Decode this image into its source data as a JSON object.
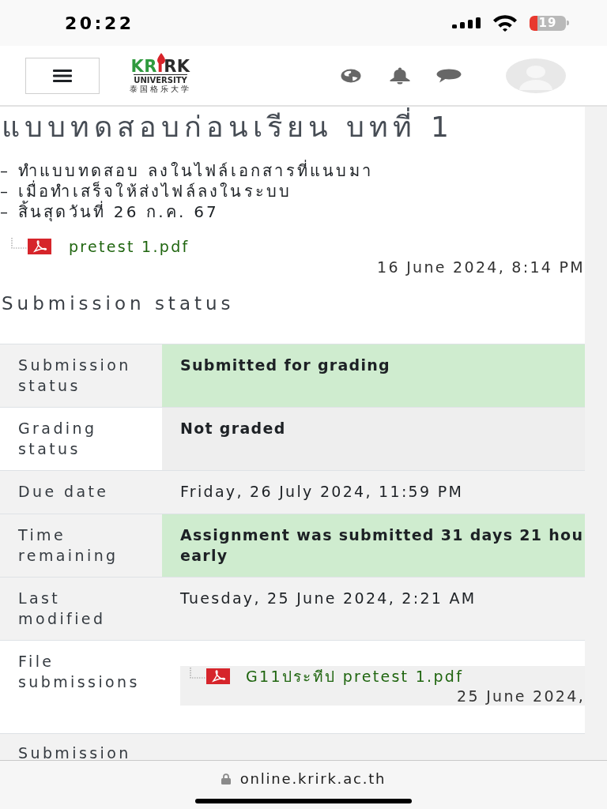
{
  "status_bar": {
    "time": "20:22",
    "battery": "19"
  },
  "header": {
    "logo": {
      "wordmark": "KRIRK",
      "subtitle": "UNIVERSITY",
      "chinese": "泰国格乐大学"
    }
  },
  "assignment": {
    "title": "แบบทดสอบก่อนเรียน บทที่ 1",
    "instructions": [
      "– ทำแบบทดสอบ ลงในไฟล์เอกสารที่แนบมา",
      "– เมื่อทำเสร็จให้ส่งไฟล์ลงในระบบ",
      "– สิ้นสุดวันที่ 26 ก.ค. 67"
    ],
    "attachment": {
      "name": "pretest 1.pdf",
      "date": "16 June 2024, 8:14 PM"
    }
  },
  "submission_status": {
    "heading": "Submission status",
    "rows": [
      {
        "label": "Submission status",
        "kind": "success",
        "value": "Submitted for grading",
        "shaded": true
      },
      {
        "label": "Grading status",
        "kind": "muted",
        "value": "Not graded",
        "shaded": false
      },
      {
        "label": "Due date",
        "kind": "plain",
        "value": "Friday, 26 July 2024, 11:59 PM",
        "shaded": true
      },
      {
        "label": "Time remaining",
        "kind": "success",
        "value": "Assignment was submitted 31 days 21 hou\nearly",
        "shaded": true
      },
      {
        "label": "Last modified",
        "kind": "plain",
        "value": "Tuesday, 25 June 2024, 2:21 AM",
        "shaded": true
      },
      {
        "label": "File submissions",
        "kind": "file",
        "file": {
          "name": "G11ประทีป pretest 1.pdf",
          "date": "25 June 2024,"
        },
        "shaded": false
      },
      {
        "label": "Submission",
        "kind": "plain",
        "shaded": true
      }
    ]
  },
  "browser_bar": {
    "url": "online.krirk.ac.th"
  }
}
